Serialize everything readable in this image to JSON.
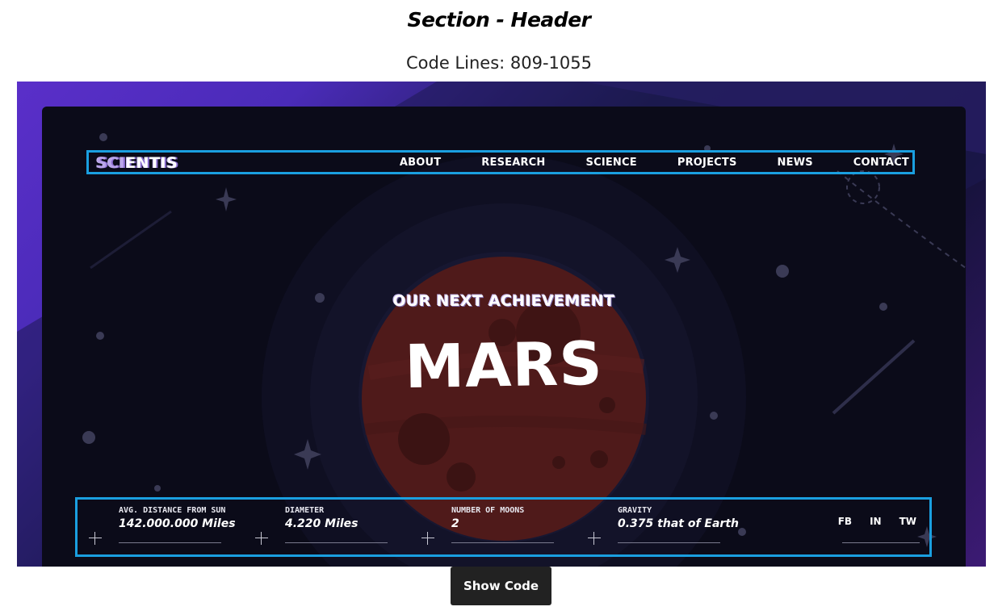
{
  "page": {
    "title": "Section - Header",
    "code_lines": "Code Lines: 809-1055",
    "show_code_label": "Show Code"
  },
  "header": {
    "logo_first": "SCI",
    "logo_rest": "ENTIS",
    "nav": [
      {
        "label": "ABOUT"
      },
      {
        "label": "RESEARCH"
      },
      {
        "label": "SCIENCE"
      },
      {
        "label": "PROJECTS"
      },
      {
        "label": "NEWS"
      },
      {
        "label": "CONTACT"
      }
    ]
  },
  "hero": {
    "subtitle": "OUR NEXT ACHIEVEMENT",
    "planet": "MARS"
  },
  "stats": [
    {
      "label": "AVG. DISTANCE FROM SUN",
      "value": "142.000.000 Miles"
    },
    {
      "label": "DIAMETER",
      "value": "4.220 Miles"
    },
    {
      "label": "NUMBER OF MOONS",
      "value": "2"
    },
    {
      "label": "GRAVITY",
      "value": "0.375 that of Earth"
    }
  ],
  "socials": [
    {
      "label": "FB"
    },
    {
      "label": "IN"
    },
    {
      "label": "TW"
    }
  ],
  "colors": {
    "highlight_border": "#1a9fe0",
    "card_bg": "#0b0b19",
    "planet": "#5e1d1d",
    "button_bg": "#222222"
  },
  "icons": [
    "plus-icon",
    "star-icon",
    "planet-mars"
  ]
}
